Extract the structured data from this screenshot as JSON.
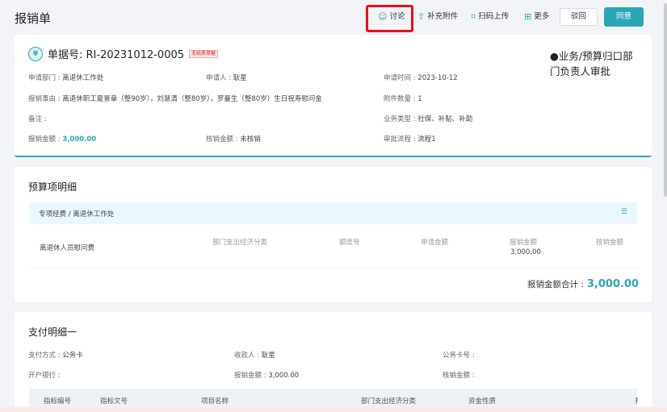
{
  "header": {
    "title": "报销单",
    "toolbar": [
      {
        "icon": "chat-bubble-icon",
        "glyph": "☺",
        "label": "讨论"
      },
      {
        "icon": "upload-icon",
        "glyph": "⇧",
        "label": "补充附件"
      },
      {
        "icon": "scan-icon",
        "glyph": "⌗",
        "label": "扫码上传"
      },
      {
        "icon": "more-grid-icon",
        "glyph": "⊞",
        "label": "更多"
      }
    ],
    "reject_label": "驳回",
    "agree_label": "同意"
  },
  "document": {
    "icon_glyph": "¥",
    "number_label": "单据号: RI-20231012-0005",
    "badge": "无纸质单据",
    "approval_status": "●业务/预算归口部门负责人审批",
    "fields": {
      "dept_label": "申请部门 : ",
      "dept_value": "离退休工作处",
      "applicant_label": "申请人 : ",
      "applicant_value": "耿星",
      "apply_time_label": "申请时间 : ",
      "apply_time_value": "2023-10-12",
      "reason_label": "报销事由 : ",
      "reason_value": "离退休职工夏景章（整90岁），刘慧清（整80岁），罗曼生（整80岁）生日祝寿慰问金",
      "attach_label": "附件数量 : ",
      "attach_value": "1",
      "note_label": "备注 : ",
      "note_value": "",
      "biz_type_label": "业务类型 : ",
      "biz_type_value": "社保、补贴、补助",
      "amount_label": "报销金额 : ",
      "amount_value": "3,000.00",
      "verify_label": "核销金额 : ",
      "verify_value": "未核销",
      "flow_label": "审批流程 : ",
      "flow_value": "流程1"
    }
  },
  "budget": {
    "title": "预算项明细",
    "path": "专项经费  /  离退休工作处",
    "menu_glyph": "☰",
    "columns": [
      "部门支出经济分类",
      "额度号",
      "申请金额",
      "报销金额",
      "核销金额"
    ],
    "row": {
      "name": "离退休人员慰问费",
      "reimburse_amount": "3,000.00"
    },
    "total_label": "报销金额合计 :",
    "total_value": "3,000.00"
  },
  "payment": {
    "title": "支付明细一",
    "pay_method_label": "支付方式 : ",
    "pay_method_value": "公务卡",
    "payee_label": "收款人 : ",
    "payee_value": "耿星",
    "card_no_label": "公务卡号 : ",
    "card_no_value": "",
    "bank_label": "开户银行 : ",
    "bank_value": "",
    "amount_label": "报销金额 : ",
    "amount_value": "3,000.00",
    "verify_label": "核销金额 : ",
    "verify_value": "",
    "columns": [
      "指标编号",
      "指标文号",
      "项目名称",
      "部门支出经济分类",
      "资金性质",
      "扌"
    ]
  },
  "colors": {
    "accent": "#2ba6b7",
    "highlight": "#e8101a"
  }
}
